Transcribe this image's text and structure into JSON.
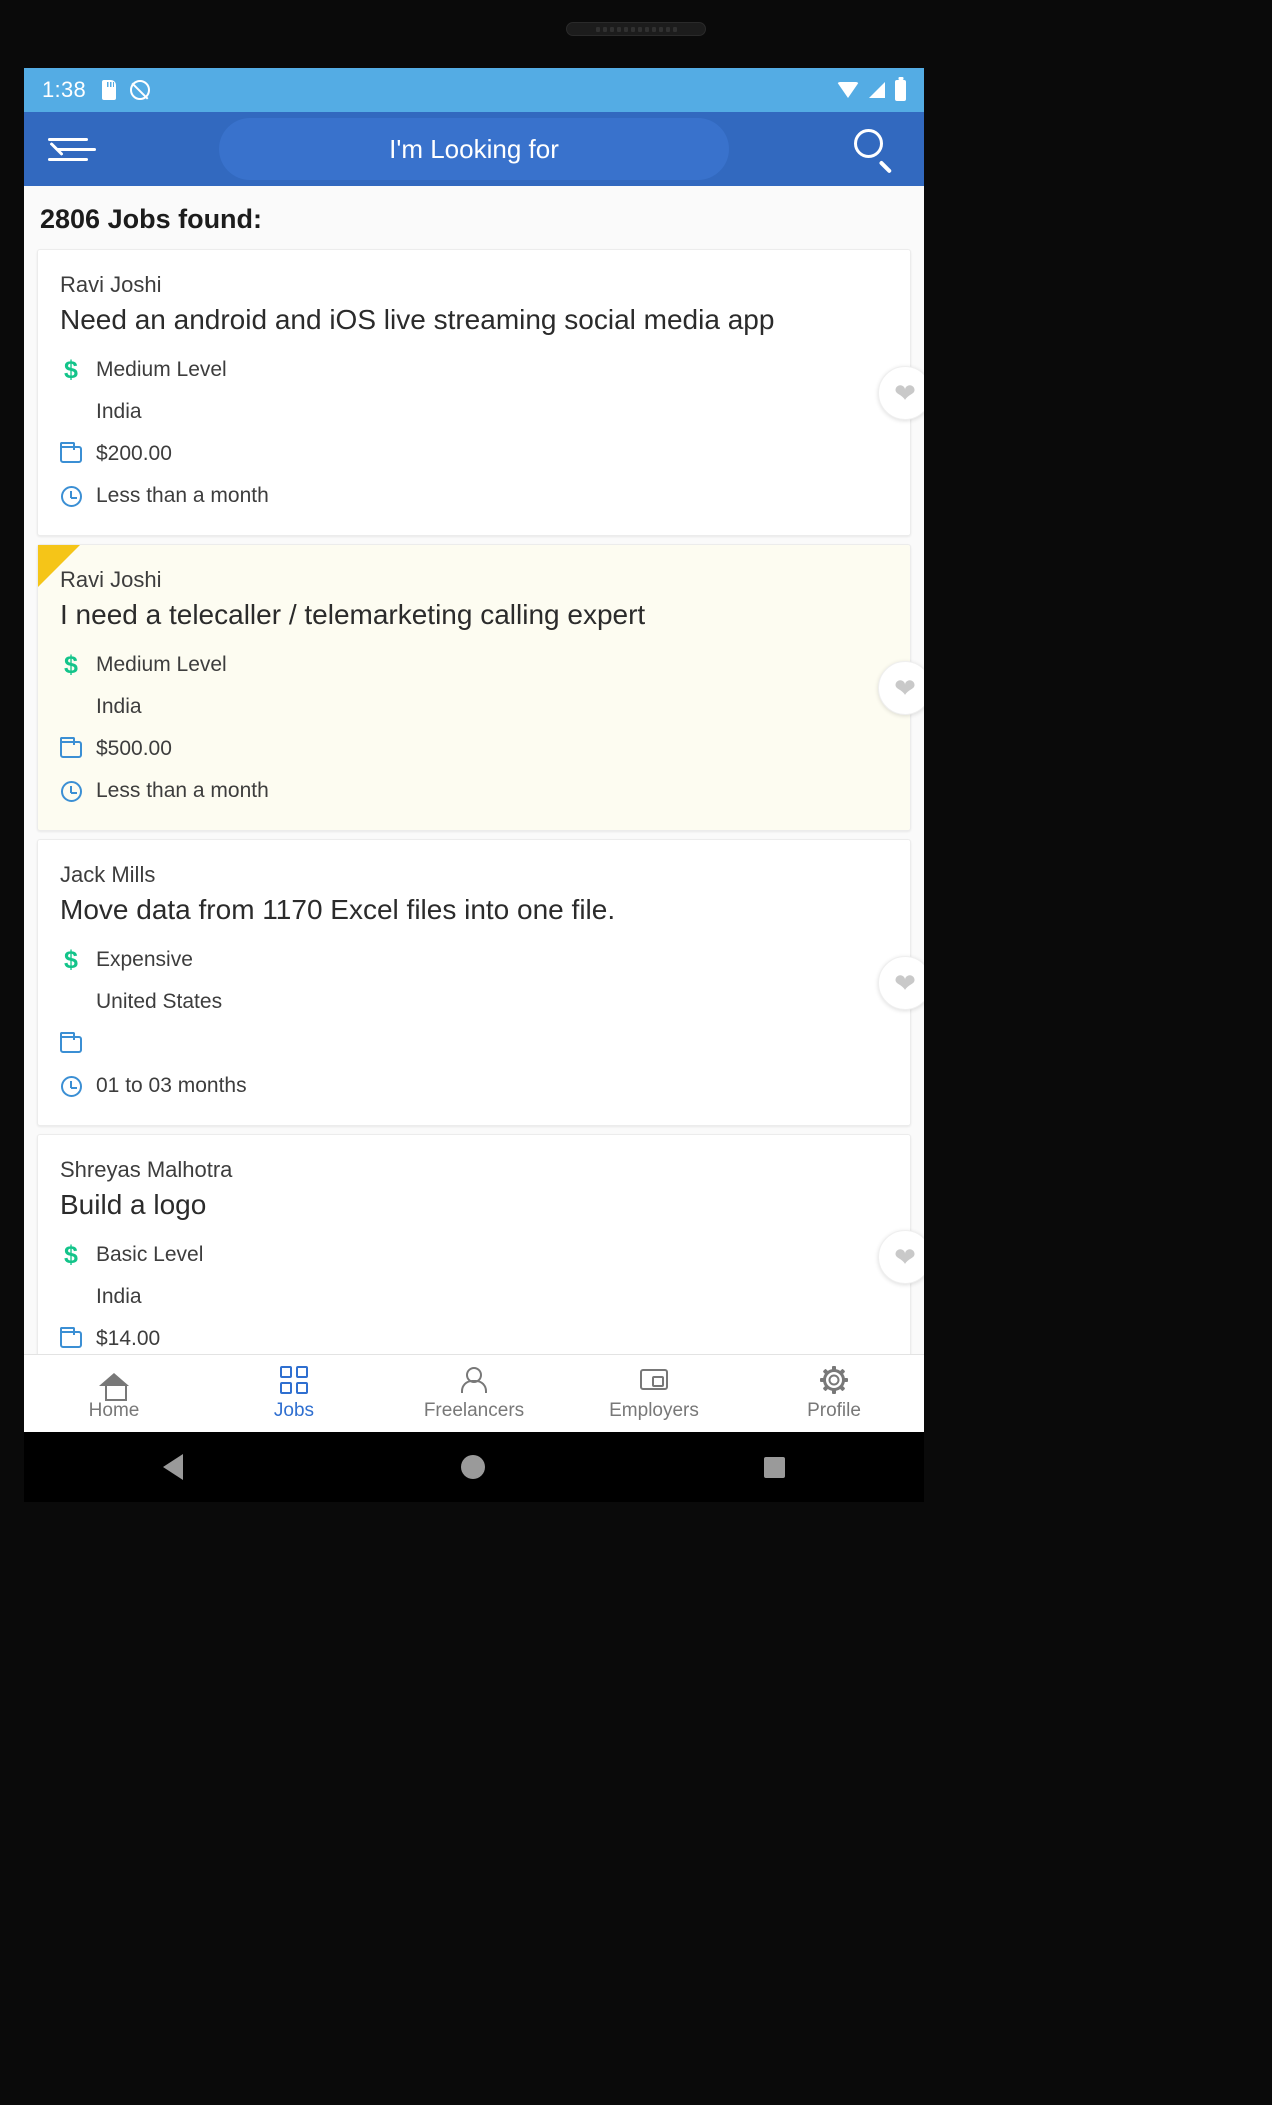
{
  "statusbar": {
    "time": "1:38",
    "icons_left": [
      "sd-card-icon",
      "mute-icon"
    ],
    "icons_right": [
      "wifi-icon",
      "signal-icon",
      "battery-icon"
    ]
  },
  "appbar": {
    "menu_icon": "back-menu-icon",
    "search_placeholder": "I'm Looking for",
    "search_icon": "search-icon"
  },
  "main": {
    "results_heading": "2806 Jobs found:",
    "jobs": [
      {
        "poster": "Ravi Joshi",
        "title": "Need an android and iOS live streaming social media app",
        "level": "Medium Level",
        "location": "India",
        "budget": "$200.00",
        "duration": "Less than a month",
        "featured": false,
        "favorite_icon": "heart-icon"
      },
      {
        "poster": "Ravi Joshi",
        "title": "I need a telecaller / telemarketing calling expert",
        "level": "Medium Level",
        "location": "India",
        "budget": "$500.00",
        "duration": "Less than a month",
        "featured": true,
        "favorite_icon": "heart-icon"
      },
      {
        "poster": "Jack Mills",
        "title": "Move data from 1170 Excel files into one file.",
        "level": "Expensive",
        "location": "United States",
        "budget": "",
        "duration": "01 to 03 months",
        "featured": false,
        "favorite_icon": "heart-icon"
      },
      {
        "poster": "Shreyas Malhotra",
        "title": "Build a logo",
        "level": "Basic Level",
        "location": "India",
        "budget": "$14.00",
        "duration": "",
        "featured": false,
        "favorite_icon": "heart-icon"
      }
    ]
  },
  "bottomnav": {
    "items": [
      {
        "label": "Home",
        "icon": "home-icon",
        "active": false
      },
      {
        "label": "Jobs",
        "icon": "grid-icon",
        "active": true
      },
      {
        "label": "Freelancers",
        "icon": "person-icon",
        "active": false
      },
      {
        "label": "Employers",
        "icon": "wallet-icon",
        "active": false
      },
      {
        "label": "Profile",
        "icon": "gear-icon",
        "active": false
      }
    ]
  },
  "androidnav": {
    "back": "back-triangle-icon",
    "home": "home-circle-icon",
    "recents": "recents-square-icon"
  },
  "colors": {
    "status_bar": "#54ace4",
    "app_bar": "#3269bf",
    "accent": "#2f6fd0",
    "money_green": "#13c48a",
    "icon_blue": "#3b8fd4",
    "featured_bg": "#fdfcf1",
    "ribbon": "#f5c518"
  }
}
